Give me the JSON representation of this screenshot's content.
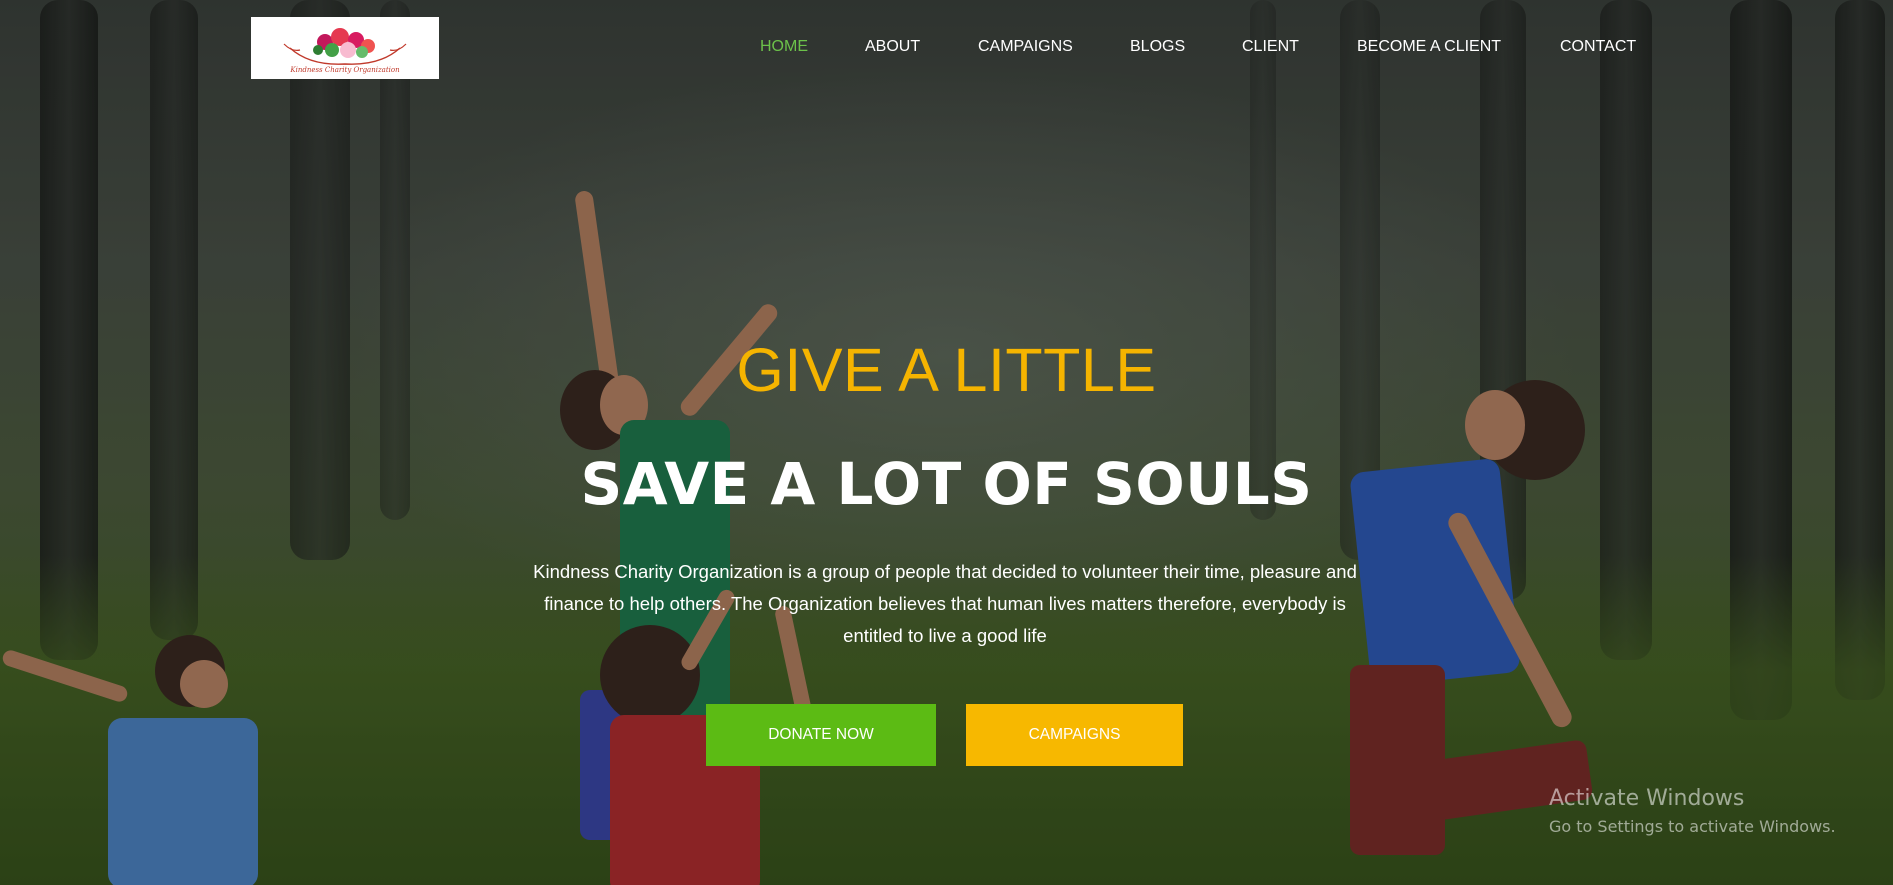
{
  "logo": {
    "caption": "Kindness Charity Organization"
  },
  "nav": {
    "items": [
      {
        "label": "HOME",
        "active": true
      },
      {
        "label": "ABOUT",
        "active": false
      },
      {
        "label": "CAMPAIGNS",
        "active": false
      },
      {
        "label": "BLOGS",
        "active": false
      },
      {
        "label": "CLIENT",
        "active": false
      },
      {
        "label": "BECOME A CLIENT",
        "active": false
      },
      {
        "label": "CONTACT",
        "active": false
      }
    ]
  },
  "hero": {
    "title_small": "GIVE A LITTLE",
    "title_big": "SAVE A LOT OF SOULS",
    "description_lines": [
      "Kindness Charity Organization is a group of people that decided to volunteer their time, pleasure and",
      "finance to help others. The Organization believes that human lives matters therefore, everybody is",
      "entitled to live a good life"
    ],
    "donate_label": "DONATE NOW",
    "campaigns_label": "CAMPAIGNS"
  },
  "watermark": {
    "title": "Activate Windows",
    "subtitle": "Go to Settings to activate Windows."
  },
  "colors": {
    "accent_green": "#5cbb14",
    "accent_yellow": "#f7b800",
    "active_nav": "#6cc24a",
    "title_small": "#f5b400"
  }
}
